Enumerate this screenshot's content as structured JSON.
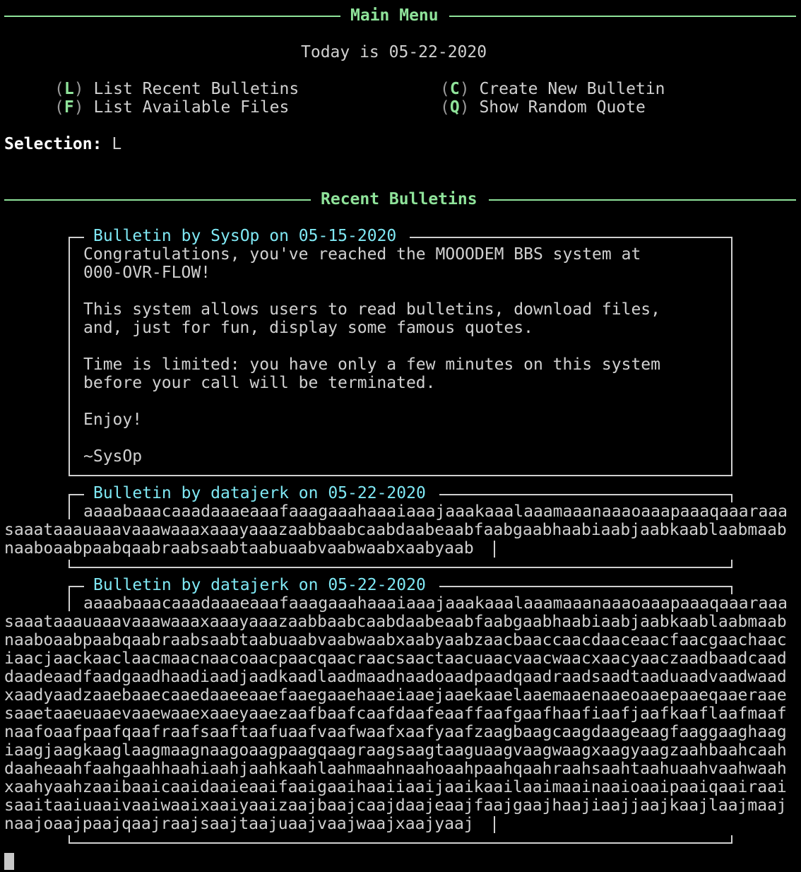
{
  "menu": {
    "title": "Main Menu",
    "date_line": "Today is 05-22-2020",
    "options": [
      {
        "key": "L",
        "label": "List Recent Bulletins"
      },
      {
        "key": "F",
        "label": "List Available Files"
      },
      {
        "key": "C",
        "label": "Create New Bulletin"
      },
      {
        "key": "Q",
        "label": "Show Random Quote"
      }
    ],
    "selection_label": "Selection:",
    "selection_value": "L"
  },
  "recent": {
    "title": "Recent Bulletins",
    "bulletins": [
      {
        "header": "Bulletin by SysOp on 05-15-2020",
        "lines": [
          "Congratulations, you've reached the MOOODEM BBS system at",
          "000-OVR-FLOW!",
          "",
          "This system allows users to read bulletins, download files,",
          "and, just for fun, display some famous quotes.",
          "",
          "Time is limited: you have only a few minutes on this system",
          "before your call will be terminated.",
          "",
          "Enjoy!",
          "",
          "~SysOp"
        ]
      },
      {
        "header": "Bulletin by datajerk on 05-22-2020",
        "lines": [
          "aaaabaaacaaadaaaeaaafaaagaaahaaaiaaajaaakaaalaaamaaanaaaoaaapaaaqaaaraaa",
          "saaataaauaaavaaawaaaxaaayaaazaabbaabcaabdaabeaabfaabgaabhaabiaabjaabkaablaabmaab",
          "naaboaabpaabqaabraabsaabtaabuaabvaabwaabxaabyaab"
        ]
      },
      {
        "header": "Bulletin by datajerk on 05-22-2020",
        "lines": [
          "aaaabaaacaaadaaaeaaafaaagaaahaaaiaaajaaakaaalaaamaaanaaaoaaapaaaqaaaraaa",
          "saaataaauaaavaaawaaaxaaayaaazaabbaabcaabdaabeaabfaabgaabhaabiaabjaabkaablaabmaab",
          "naaboaabpaabqaabraabsaabtaabuaabvaabwaabxaabyaabzaacbaaccaacdaaceaacfaacgaachaac",
          "iaacjaackaaclaacmaacnaacoaacpaacqaacraacsaactaacuaacvaacwaacxaacyaaczaadbaadcaad",
          "daadeaadfaadgaadhaadiaadjaadkaadlaadmaadnaadoaadpaadqaadraadsaadtaaduaadvaadwaad",
          "xaadyaadzaaebaaecaaedaaeeaaefaaegaaehaaeiaaejaaekaaelaaemaaenaaeoaaepaaeqaaeraae",
          "saaetaaeuaaevaaewaaexaaeyaaezaafbaafcaafdaafeaaffaafgaafhaafiaafjaafkaaflaafmaaf",
          "naafoaafpaafqaafraafsaaftaafuaafvaafwaafxaafyaafzaagbaagcaagdaageaagfaaggaaghaag",
          "iaagjaagkaaglaagmaagnaagoaagpaagqaagraagsaagtaaguaagvaagwaagxaagyaagzaahbaahcaah",
          "daaheaahfaahgaahhaahiaahjaahkaahlaahmaahnaahoaahpaahqaahraahsaahtaahuaahvaahwaah",
          "xaahyaahzaaibaaicaaidaaieaaifaaigaaihaaiiaaijaaikaailaaimaainaaioaaipaaiqaairaai",
          "saaitaaiuaaivaaiwaaixaaiyaaizaajbaajcaajdaajeaajfaajgaajhaajiaajjaajkaajlaajmaaj",
          "naajoaajpaajqaajraajsaajtaajuaajvaajwaajxaajyaaj"
        ]
      }
    ]
  },
  "colors": {
    "accent_green": "#8fe39a",
    "header_cyan": "#7fe8f4",
    "text": "#d0d0d0",
    "background": "#000000"
  }
}
